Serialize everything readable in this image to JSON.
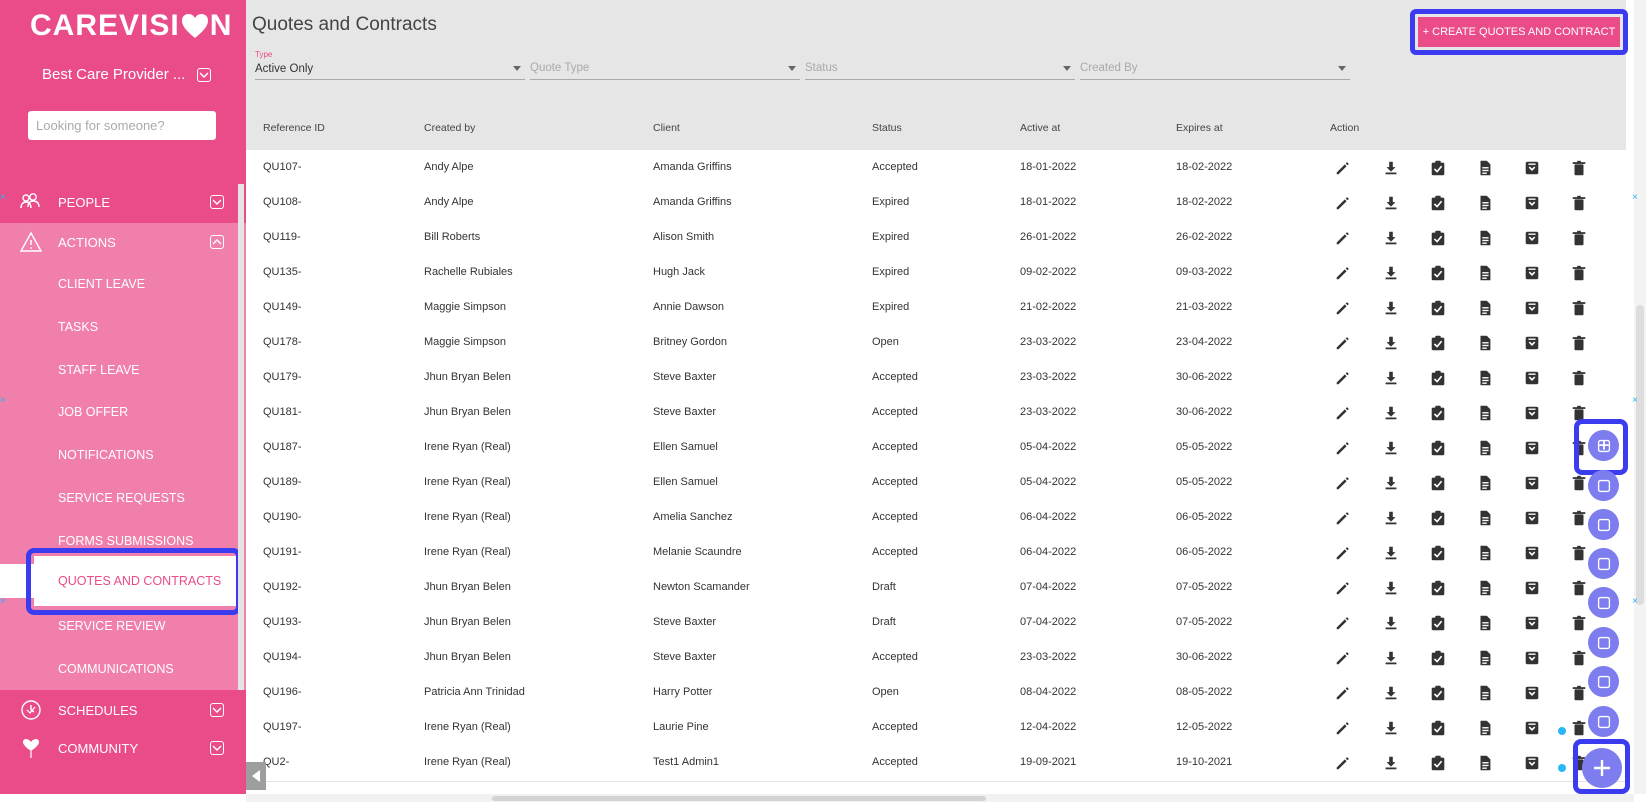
{
  "app": {
    "logo_left": "CAREVISI",
    "logo_right": "N"
  },
  "sidebar": {
    "org_name": "Best Care Provider ...",
    "search_placeholder": "Looking for someone?",
    "main_items": [
      {
        "label": "PEOPLE",
        "icon": "people-icon"
      },
      {
        "label": "ACTIONS",
        "icon": "warning-icon"
      },
      {
        "label": "SCHEDULES",
        "icon": "clock-icon"
      },
      {
        "label": "COMMUNITY",
        "icon": "balloon-heart-icon"
      }
    ],
    "sub_items": [
      "CLIENT LEAVE",
      "TASKS",
      "STAFF LEAVE",
      "JOB OFFER",
      "NOTIFICATIONS",
      "SERVICE REQUESTS",
      "FORMS SUBMISSIONS",
      "QUOTES AND CONTRACTS",
      "SERVICE REVIEW",
      "COMMUNICATIONS"
    ],
    "active_item": "QUOTES AND CONTRACTS"
  },
  "page": {
    "title": "Quotes and Contracts",
    "create_button": "+ CREATE QUOTES AND CONTRACT"
  },
  "filters": [
    {
      "label": "Type",
      "value": "Active Only",
      "placeholder": ""
    },
    {
      "label": "",
      "value": "",
      "placeholder": "Quote Type"
    },
    {
      "label": "",
      "value": "",
      "placeholder": "Status"
    },
    {
      "label": "",
      "value": "",
      "placeholder": "Created By"
    }
  ],
  "table": {
    "columns": [
      "Reference ID",
      "Created by",
      "Client",
      "Status",
      "Active at",
      "Expires at",
      "Action"
    ],
    "rows": [
      [
        "QU107-",
        "Andy Alpe",
        "Amanda Griffins",
        "Accepted",
        "18-01-2022",
        "18-02-2022"
      ],
      [
        "QU108-",
        "Andy Alpe",
        "Amanda Griffins",
        "Expired",
        "18-01-2022",
        "18-02-2022"
      ],
      [
        "QU119-",
        "Bill Roberts",
        "Alison Smith",
        "Expired",
        "26-01-2022",
        "26-02-2022"
      ],
      [
        "QU135-",
        "Rachelle Rubiales",
        "Hugh Jack",
        "Expired",
        "09-02-2022",
        "09-03-2022"
      ],
      [
        "QU149-",
        "Maggie Simpson",
        "Annie Dawson",
        "Expired",
        "21-02-2022",
        "21-03-2022"
      ],
      [
        "QU178-",
        "Maggie Simpson",
        "Britney Gordon",
        "Open",
        "23-03-2022",
        "23-04-2022"
      ],
      [
        "QU179-",
        "Jhun Bryan Belen",
        "Steve Baxter",
        "Accepted",
        "23-03-2022",
        "30-06-2022"
      ],
      [
        "QU181-",
        "Jhun Bryan Belen",
        "Steve Baxter",
        "Accepted",
        "23-03-2022",
        "30-06-2022"
      ],
      [
        "QU187-",
        "Irene Ryan (Real)",
        "Ellen Samuel",
        "Accepted",
        "05-04-2022",
        "05-05-2022"
      ],
      [
        "QU189-",
        "Irene Ryan (Real)",
        "Ellen Samuel",
        "Accepted",
        "05-04-2022",
        "05-05-2022"
      ],
      [
        "QU190-",
        "Irene Ryan (Real)",
        "Amelia Sanchez",
        "Accepted",
        "06-04-2022",
        "06-05-2022"
      ],
      [
        "QU191-",
        "Irene Ryan (Real)",
        "Melanie Scaundre",
        "Accepted",
        "06-04-2022",
        "06-05-2022"
      ],
      [
        "QU192-",
        "Jhun Bryan Belen",
        "Newton Scamander",
        "Draft",
        "07-04-2022",
        "07-05-2022"
      ],
      [
        "QU193-",
        "Jhun Bryan Belen",
        "Steve Baxter",
        "Draft",
        "07-04-2022",
        "07-05-2022"
      ],
      [
        "QU194-",
        "Jhun Bryan Belen",
        "Steve Baxter",
        "Accepted",
        "23-03-2022",
        "30-06-2022"
      ],
      [
        "QU196-",
        "Patricia Ann Trinidad",
        "Harry Potter",
        "Open",
        "08-04-2022",
        "08-05-2022"
      ],
      [
        "QU197-",
        "Irene Ryan (Real)",
        "Laurie Pine",
        "Accepted",
        "12-04-2022",
        "12-05-2022"
      ],
      [
        "QU2-",
        "Irene Ryan (Real)",
        "Test1 Admin1",
        "Accepted",
        "19-09-2021",
        "19-10-2021"
      ]
    ],
    "action_icons": [
      "pencil-icon",
      "download-icon",
      "clipboard-check-icon",
      "document-icon",
      "archive-icon",
      "trash-icon"
    ]
  },
  "fab_menu": [
    "add-copy-icon",
    "print-icon",
    "invoice-icon",
    "notes-icon",
    "group-icon",
    "add-person-icon",
    "hand-icon",
    "person-settings-icon",
    "plus-icon"
  ],
  "colors": {
    "brand": "#ea4c89",
    "brand_light": "#f07fab",
    "highlight": "#3b3bf0",
    "fab": "#7d7df0"
  }
}
